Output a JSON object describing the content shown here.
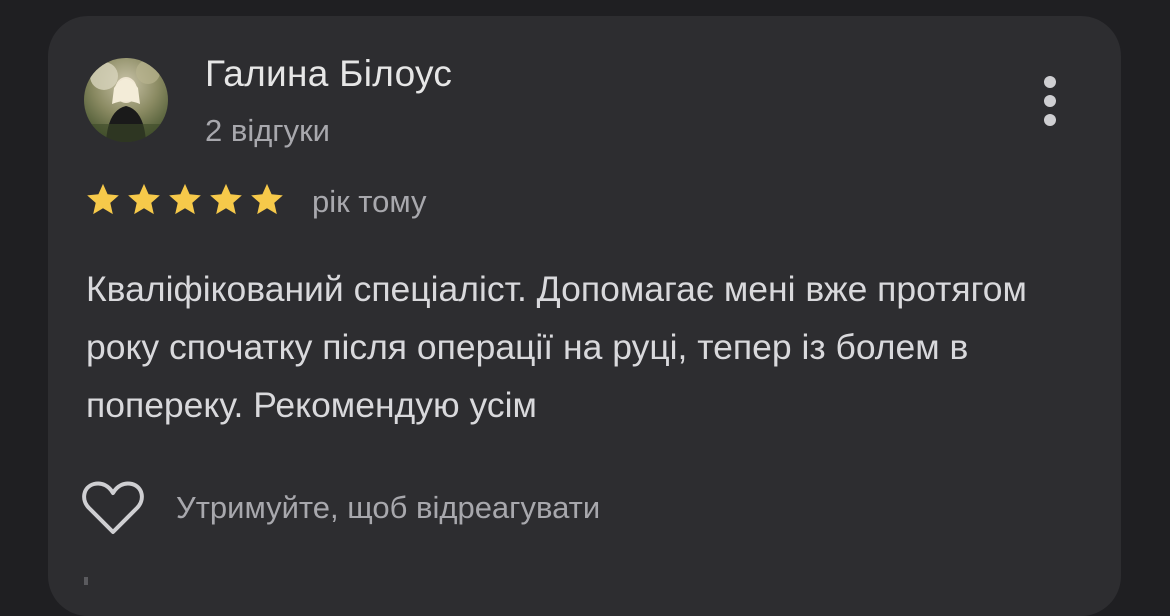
{
  "review": {
    "author_name": "Галина Білоус",
    "author_reviews": "2 відгуки",
    "rating": 5,
    "rating_max": 5,
    "star_color": "#f6c94a",
    "time_ago": "рік тому",
    "text": "Кваліфікований спеціаліст. Допомагає мені вже протягом року спочатку після операції на руці, тепер із болем в попереку. Рекомендую усім",
    "react_hint": "Утримуйте, щоб відреагувати",
    "react_icon": "heart-outline-icon",
    "menu_icon": "more-vert-icon"
  }
}
